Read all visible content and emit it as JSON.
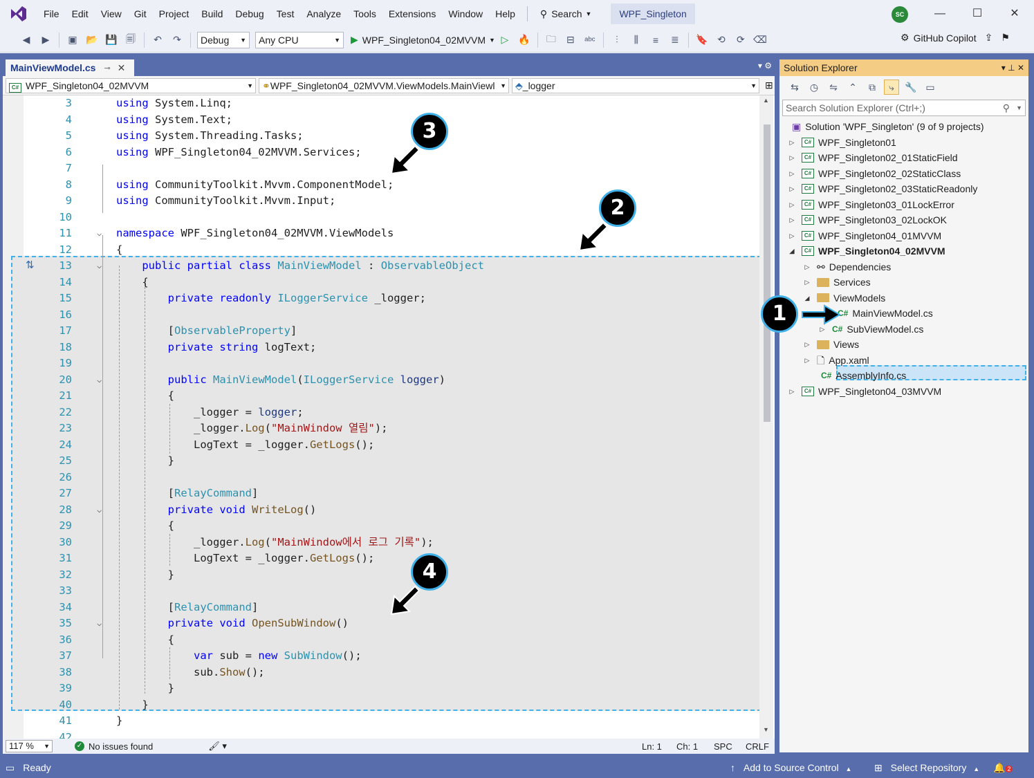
{
  "menu": {
    "items": [
      "File",
      "Edit",
      "View",
      "Git",
      "Project",
      "Build",
      "Debug",
      "Test",
      "Analyze",
      "Tools",
      "Extensions",
      "Window",
      "Help"
    ],
    "search_label": "Search",
    "solution_name": "WPF_Singleton",
    "avatar_initials": "SC"
  },
  "toolbar": {
    "config": "Debug",
    "platform": "Any CPU",
    "startup_project": "WPF_Singleton04_02MVVM",
    "copilot": "GitHub Copilot"
  },
  "editor": {
    "tab_label": "MainViewModel.cs",
    "nav_project": "WPF_Singleton04_02MVVM",
    "nav_class": "WPF_Singleton04_02MVVM.ViewModels.MainViewl",
    "nav_member": "_logger",
    "zoom": "117 %",
    "issues": "No issues found",
    "ln": "Ln: 1",
    "ch": "Ch: 1",
    "spc": "SPC",
    "crlf": "CRLF",
    "lines": [
      {
        "n": "3",
        "code": "using System.Linq;"
      },
      {
        "n": "4",
        "code": "using System.Text;"
      },
      {
        "n": "5",
        "code": "using System.Threading.Tasks;"
      },
      {
        "n": "6",
        "code": "using WPF_Singleton04_02MVVM.Services;"
      },
      {
        "n": "7",
        "code": ""
      },
      {
        "n": "8",
        "code": "using CommunityToolkit.Mvvm.ComponentModel;"
      },
      {
        "n": "9",
        "code": "using CommunityToolkit.Mvvm.Input;"
      },
      {
        "n": "10",
        "code": ""
      },
      {
        "n": "11",
        "code": "namespace WPF_Singleton04_02MVVM.ViewModels"
      },
      {
        "n": "12",
        "code": "{"
      },
      {
        "n": "13",
        "code": "    public partial class MainViewModel : ObservableObject"
      },
      {
        "n": "14",
        "code": "    {"
      },
      {
        "n": "15",
        "code": "        private readonly ILoggerService _logger;"
      },
      {
        "n": "16",
        "code": ""
      },
      {
        "n": "17",
        "code": "        [ObservableProperty]"
      },
      {
        "n": "18",
        "code": "        private string logText;"
      },
      {
        "n": "19",
        "code": ""
      },
      {
        "n": "20",
        "code": "        public MainViewModel(ILoggerService logger)"
      },
      {
        "n": "21",
        "code": "        {"
      },
      {
        "n": "22",
        "code": "            _logger = logger;"
      },
      {
        "n": "23",
        "code": "            _logger.Log(\"MainWindow 열림\");"
      },
      {
        "n": "24",
        "code": "            LogText = _logger.GetLogs();"
      },
      {
        "n": "25",
        "code": "        }"
      },
      {
        "n": "26",
        "code": ""
      },
      {
        "n": "27",
        "code": "        [RelayCommand]"
      },
      {
        "n": "28",
        "code": "        private void WriteLog()"
      },
      {
        "n": "29",
        "code": "        {"
      },
      {
        "n": "30",
        "code": "            _logger.Log(\"MainWindow에서 로그 기록\");"
      },
      {
        "n": "31",
        "code": "            LogText = _logger.GetLogs();"
      },
      {
        "n": "32",
        "code": "        }"
      },
      {
        "n": "33",
        "code": ""
      },
      {
        "n": "34",
        "code": "        [RelayCommand]"
      },
      {
        "n": "35",
        "code": "        private void OpenSubWindow()"
      },
      {
        "n": "36",
        "code": "        {"
      },
      {
        "n": "37",
        "code": "            var sub = new SubWindow();"
      },
      {
        "n": "38",
        "code": "            sub.Show();"
      },
      {
        "n": "39",
        "code": "        }"
      },
      {
        "n": "40",
        "code": "    }"
      },
      {
        "n": "41",
        "code": "}"
      },
      {
        "n": "42",
        "code": ""
      }
    ]
  },
  "solution_explorer": {
    "title": "Solution Explorer",
    "search_placeholder": "Search Solution Explorer (Ctrl+;)",
    "solution_label": "Solution 'WPF_Singleton' (9 of 9 projects)",
    "projects": [
      "WPF_Singleton01",
      "WPF_Singleton02_01StaticField",
      "WPF_Singleton02_02StaticClass",
      "WPF_Singleton02_03StaticReadonly",
      "WPF_Singleton03_01LockError",
      "WPF_Singleton03_02LockOK",
      "WPF_Singleton04_01MVVM",
      "WPF_Singleton04_02MVVM"
    ],
    "children": {
      "dependencies": "Dependencies",
      "services": "Services",
      "viewmodels": "ViewModels",
      "main_vm": "MainViewModel.cs",
      "sub_vm": "SubViewModel.cs",
      "views": "Views",
      "app_xaml": "App.xaml",
      "assembly_info": "AssemblyInfo.cs"
    },
    "last_project": "WPF_Singleton04_03MVVM"
  },
  "statusbar": {
    "ready": "Ready",
    "add_source": "Add to Source Control",
    "select_repo": "Select Repository",
    "notifications": "2"
  },
  "callouts": [
    "1",
    "2",
    "3",
    "4"
  ],
  "colors": {
    "accent": "#586dab",
    "callout_border": "#3fb0e8",
    "solution_explorer_title": "#f5cc84"
  }
}
